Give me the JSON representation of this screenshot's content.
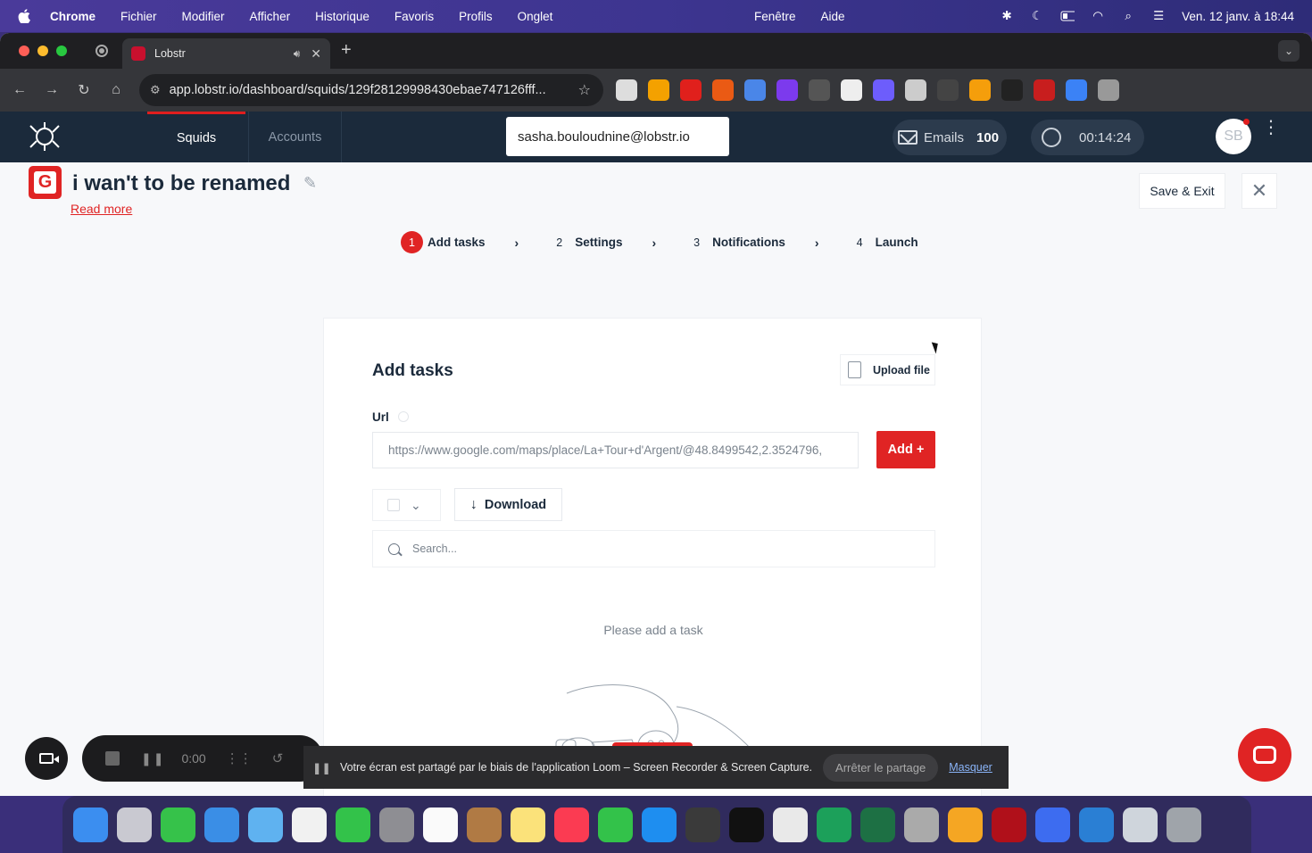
{
  "menubar": {
    "app": "Chrome",
    "items": [
      "Fichier",
      "Modifier",
      "Afficher",
      "Historique",
      "Favoris",
      "Profils",
      "Onglet"
    ],
    "items_right": [
      "Fenêtre",
      "Aide"
    ],
    "datetime": "Ven. 12 janv. à  18:44"
  },
  "browser": {
    "tab_title": "Lobstr",
    "url": "app.lobstr.io/dashboard/squids/129f28129998430ebae747126fff..."
  },
  "appbar": {
    "nav": {
      "squids": "Squids",
      "accounts": "Accounts"
    },
    "account_email": "sasha.bouloudnine@lobstr.io",
    "emails_label": "Emails",
    "emails_count": "100",
    "timer": "00:14:24",
    "avatar_initials": "SB"
  },
  "header": {
    "squid_icon_letter": "G",
    "squid_title": "i wan't to be renamed",
    "read_more": "Read more",
    "save_exit": "Save & Exit",
    "close": "✕"
  },
  "steps": [
    {
      "num": "1",
      "label": "Add tasks",
      "active": true
    },
    {
      "num": "2",
      "label": "Settings",
      "active": false
    },
    {
      "num": "3",
      "label": "Notifications",
      "active": false
    },
    {
      "num": "4",
      "label": "Launch",
      "active": false
    }
  ],
  "card": {
    "title": "Add tasks",
    "upload_label": "Upload file",
    "url_label": "Url",
    "url_value": "https://www.google.com/maps/place/La+Tour+d'Argent/@48.8499542,2.3524796,",
    "add_label": "Add +",
    "download_label": "Download",
    "search_placeholder": "Search...",
    "empty_text": "Please add a task"
  },
  "loom": {
    "time": "0:00",
    "share_text": "Votre écran est partagé par le biais de l'application Loom – Screen Recorder & Screen Capture.",
    "stop_share": "Arrêter le partage",
    "hide": "Masquer"
  },
  "colors": {
    "brand_red": "#e02424",
    "appbar_bg": "#1b2a3b"
  }
}
